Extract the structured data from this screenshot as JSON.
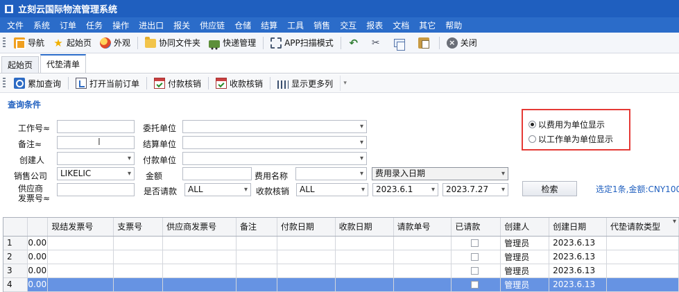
{
  "app": {
    "title": "立刻云国际物流管理系统"
  },
  "menu": [
    "文件",
    "系统",
    "订单",
    "任务",
    "操作",
    "进出口",
    "报关",
    "供应链",
    "仓储",
    "结算",
    "工具",
    "销售",
    "交互",
    "报表",
    "文档",
    "其它",
    "帮助"
  ],
  "toolbar": {
    "nav": "导航",
    "home": "起始页",
    "external": "外观",
    "shared_folder": "协同文件夹",
    "express": "快递管理",
    "app_scan": "APP扫描模式",
    "close": "关闭"
  },
  "tabs": [
    "起始页",
    "代垫清单"
  ],
  "subtoolbar": {
    "accumulate_query": "累加查询",
    "open_order": "打开当前订单",
    "payment_writeoff": "付款核销",
    "receipt_writeoff": "收款核销",
    "show_more_cols": "显示更多列"
  },
  "query": {
    "section_title": "查询条件",
    "job_no_label": "工作号≈",
    "job_no_value": "",
    "remark_label": "备注≈",
    "remark_value": "",
    "creator_label": "创建人",
    "creator_value": "",
    "sales_company_label": "销售公司",
    "sales_company_value": "LIKELIC",
    "supplier_invoice_label_1": "供应商",
    "supplier_invoice_label_2": "发票号≈",
    "supplier_invoice_value": "",
    "client_label": "委托单位",
    "client_value": "",
    "settle_label": "结算单位",
    "settle_value": "",
    "payer_label": "付款单位",
    "payer_value": "",
    "amount_label": "金额",
    "amount_value": "",
    "fee_name_label": "费用名称",
    "fee_name_value": "",
    "date_type_value": "费用录入日期",
    "requested_label": "是否请款",
    "requested_value": "ALL",
    "receipt_writeoff_label": "收款核销",
    "receipt_writeoff_value": "ALL",
    "date_from": "2023.6.1",
    "date_to": "2023.7.27",
    "search_button": "检索",
    "selected_info": "选定1条,金额:CNY100"
  },
  "display_mode": {
    "option_by_fee": "以费用为单位显示",
    "option_by_job": "以工作单为单位显示",
    "selected": "by_fee"
  },
  "grid": {
    "columns": [
      "",
      "现结发票号",
      "支票号",
      "供应商发票号",
      "备注",
      "付款日期",
      "收款日期",
      "请款单号",
      "已请款",
      "创建人",
      "创建日期",
      "代垫请款类型"
    ],
    "rows": [
      {
        "num": "1",
        "amount": "0.00",
        "creator": "管理员",
        "date": "2023.6.13"
      },
      {
        "num": "2",
        "amount": "0.00",
        "creator": "管理员",
        "date": "2023.6.13"
      },
      {
        "num": "3",
        "amount": "0.00",
        "creator": "管理员",
        "date": "2023.6.13"
      },
      {
        "num": "4",
        "amount": "0.00",
        "creator": "管理员",
        "date": "2023.6.13"
      }
    ],
    "selected_row_index": 3
  },
  "colors": {
    "title_bar": "#1f5fbf",
    "menu_bar": "#2b6cc9",
    "highlight": "#e53935",
    "selected_row": "#6693e3"
  }
}
